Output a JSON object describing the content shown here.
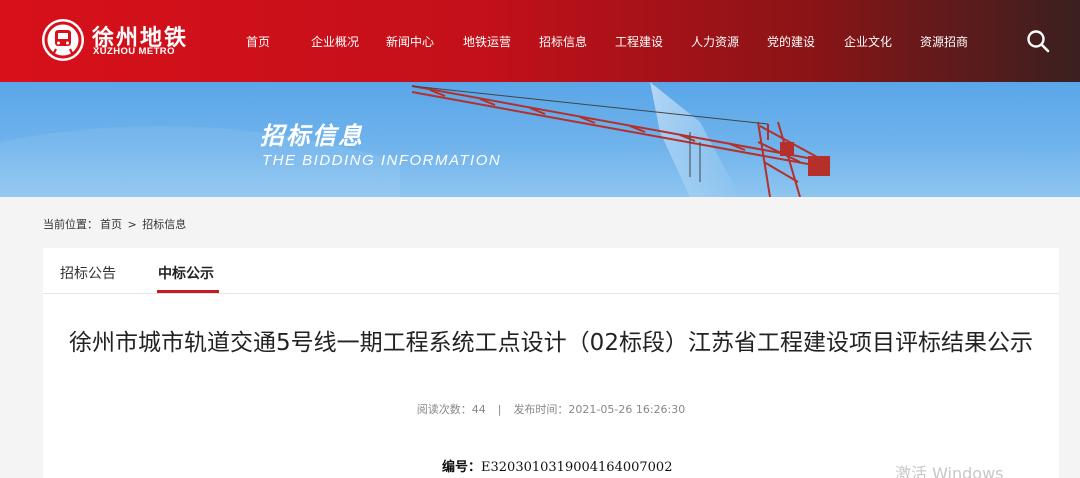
{
  "brand": {
    "name_cn": "徐州地铁",
    "name_en": "XUZHOU METRO",
    "logo_icon": "metro-logo-icon"
  },
  "nav": {
    "items": [
      {
        "label": "首页"
      },
      {
        "label": "企业概况"
      },
      {
        "label": "新闻中心"
      },
      {
        "label": "地铁运营"
      },
      {
        "label": "招标信息"
      },
      {
        "label": "工程建设"
      },
      {
        "label": "人力资源"
      },
      {
        "label": "党的建设"
      },
      {
        "label": "企业文化"
      },
      {
        "label": "资源招商"
      }
    ],
    "search_icon": "search-icon"
  },
  "banner": {
    "title": "招标信息",
    "subtitle": "THE BIDDING INFORMATION"
  },
  "breadcrumb": {
    "prefix": "当前位置：",
    "home": "首页",
    "separator": ">",
    "current": "招标信息"
  },
  "tabs": [
    {
      "label": "招标公告",
      "active": false
    },
    {
      "label": "中标公示",
      "active": true
    }
  ],
  "article": {
    "title": "徐州市城市轨道交通5号线一期工程系统工点设计（02标段）江苏省工程建设项目评标结果公示",
    "views_label": "阅读次数：44",
    "separator": "|",
    "publish_label": "发布时间：2021-05-26 16:26:30",
    "code_label": "编号：",
    "code_value": "E3203010319004164007002"
  },
  "watermark": "激活 Windows",
  "colors": {
    "header_red": "#d8101a",
    "accent_red": "#c81a22",
    "banner_sky": "#6fb3ec"
  }
}
